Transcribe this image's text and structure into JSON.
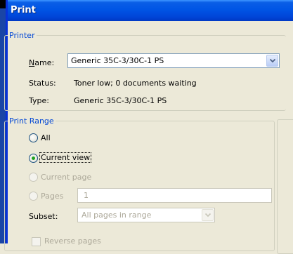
{
  "dialog": {
    "title": "Print"
  },
  "printer": {
    "legend": "Printer",
    "name_label": "Name:",
    "name_value": "Generic 35C-3/30C-1 PS",
    "status_label": "Status:",
    "status_value": "Toner low; 0 documents waiting",
    "type_label": "Type:",
    "type_value": "Generic 35C-3/30C-1 PS"
  },
  "print_range": {
    "legend": "Print Range",
    "all": "All",
    "current_view": "Current view",
    "current_page": "Current page",
    "pages": "Pages",
    "pages_value": "1",
    "subset_label": "Subset:",
    "subset_value": "All pages in range",
    "reverse_pages": "Reverse pages"
  },
  "icons": {
    "dropdown": "chevron-down-icon"
  },
  "colors": {
    "title_bar": "#0055e5",
    "legend_text": "#0046d5",
    "dialog_bg": "#ece9d8"
  }
}
